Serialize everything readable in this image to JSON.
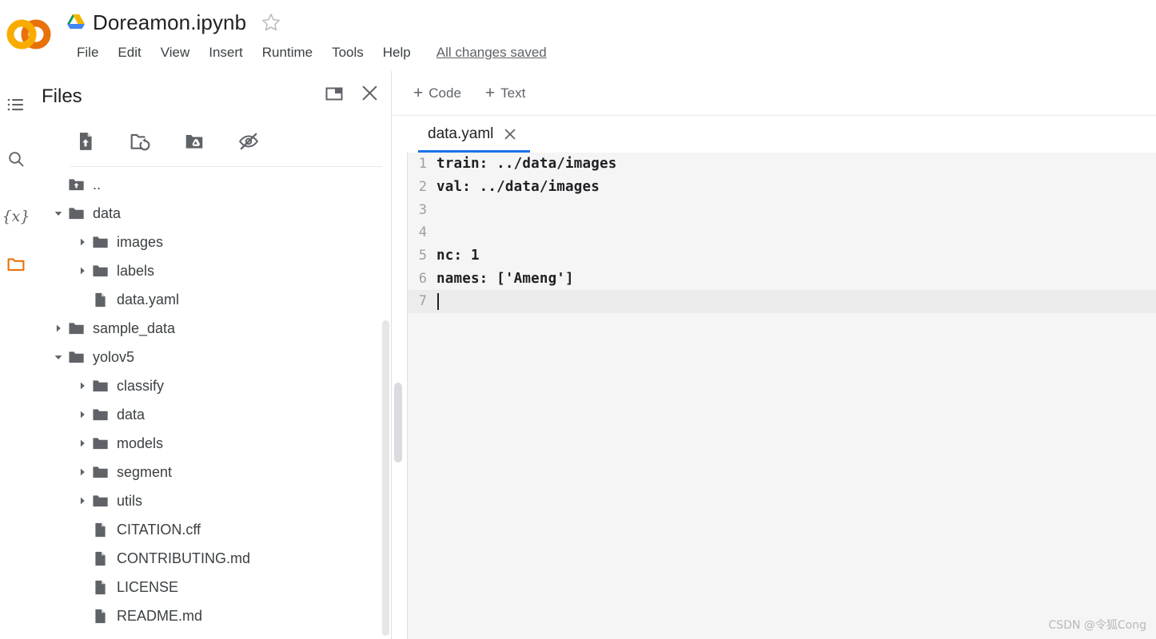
{
  "app": {
    "name": "Google Colaboratory",
    "logo_colors": {
      "light_orange": "#F9AB00",
      "dark_orange": "#E8710A"
    },
    "accent_blue": "#1a73e8"
  },
  "titlebar": {
    "doc_title": "Doreamon.ipynb",
    "drive_icon": "google-drive-icon",
    "star_icon": "star-icon",
    "star_filled": false
  },
  "menubar": {
    "items": [
      {
        "label": "File",
        "name": "menu-file"
      },
      {
        "label": "Edit",
        "name": "menu-edit"
      },
      {
        "label": "View",
        "name": "menu-view"
      },
      {
        "label": "Insert",
        "name": "menu-insert"
      },
      {
        "label": "Runtime",
        "name": "menu-runtime"
      },
      {
        "label": "Tools",
        "name": "menu-tools"
      },
      {
        "label": "Help",
        "name": "menu-help"
      }
    ],
    "save_status": "All changes saved"
  },
  "rail": {
    "items": [
      {
        "name": "table-of-contents-icon",
        "label": "Table of contents",
        "active": false
      },
      {
        "name": "search-icon",
        "label": "Find and replace",
        "active": false
      },
      {
        "name": "variables-icon",
        "label": "Variables",
        "active": false
      },
      {
        "name": "files-folder-icon",
        "label": "Files",
        "active": true
      }
    ]
  },
  "files_panel": {
    "title": "Files",
    "header_actions": [
      {
        "name": "open-in-panel-icon",
        "label": "Open in new panel"
      },
      {
        "name": "close-icon",
        "label": "Close"
      }
    ],
    "toolbar": [
      {
        "name": "upload-file-icon",
        "label": "Upload to session storage"
      },
      {
        "name": "refresh-folder-icon",
        "label": "Refresh"
      },
      {
        "name": "mount-drive-icon",
        "label": "Mount Drive"
      },
      {
        "name": "hide-hidden-files-icon",
        "label": "Show/hide hidden files"
      }
    ],
    "tree": [
      {
        "label": "..",
        "type": "parent",
        "depth": 0,
        "twisty": "none",
        "icon": "folder-up-icon"
      },
      {
        "label": "data",
        "type": "folder",
        "depth": 0,
        "twisty": "expanded",
        "icon": "folder-icon"
      },
      {
        "label": "images",
        "type": "folder",
        "depth": 1,
        "twisty": "collapsed",
        "icon": "folder-icon"
      },
      {
        "label": "labels",
        "type": "folder",
        "depth": 1,
        "twisty": "collapsed",
        "icon": "folder-icon"
      },
      {
        "label": "data.yaml",
        "type": "file",
        "depth": 1,
        "twisty": "none",
        "icon": "file-icon"
      },
      {
        "label": "sample_data",
        "type": "folder",
        "depth": 0,
        "twisty": "collapsed",
        "icon": "folder-icon"
      },
      {
        "label": "yolov5",
        "type": "folder",
        "depth": 0,
        "twisty": "expanded",
        "icon": "folder-icon"
      },
      {
        "label": "classify",
        "type": "folder",
        "depth": 1,
        "twisty": "collapsed",
        "icon": "folder-icon"
      },
      {
        "label": "data",
        "type": "folder",
        "depth": 1,
        "twisty": "collapsed",
        "icon": "folder-icon"
      },
      {
        "label": "models",
        "type": "folder",
        "depth": 1,
        "twisty": "collapsed",
        "icon": "folder-icon"
      },
      {
        "label": "segment",
        "type": "folder",
        "depth": 1,
        "twisty": "collapsed",
        "icon": "folder-icon"
      },
      {
        "label": "utils",
        "type": "folder",
        "depth": 1,
        "twisty": "collapsed",
        "icon": "folder-icon"
      },
      {
        "label": "CITATION.cff",
        "type": "file",
        "depth": 1,
        "twisty": "none",
        "icon": "file-icon"
      },
      {
        "label": "CONTRIBUTING.md",
        "type": "file",
        "depth": 1,
        "twisty": "none",
        "icon": "file-icon"
      },
      {
        "label": "LICENSE",
        "type": "file",
        "depth": 1,
        "twisty": "none",
        "icon": "file-icon"
      },
      {
        "label": "README.md",
        "type": "file",
        "depth": 1,
        "twisty": "none",
        "icon": "file-icon"
      }
    ]
  },
  "editor": {
    "cell_buttons": [
      {
        "label": "Code",
        "name": "add-code-cell-button"
      },
      {
        "label": "Text",
        "name": "add-text-cell-button"
      }
    ],
    "tab": {
      "label": "data.yaml",
      "close_icon": "close-icon",
      "active": true
    },
    "lines": [
      {
        "no": "1",
        "text": "train: ../data/images"
      },
      {
        "no": "2",
        "text": "val: ../data/images"
      },
      {
        "no": "3",
        "text": ""
      },
      {
        "no": "4",
        "text": ""
      },
      {
        "no": "5",
        "text": "nc: 1"
      },
      {
        "no": "6",
        "text": "names: ['Ameng']"
      },
      {
        "no": "7",
        "text": ""
      }
    ],
    "active_line": "7",
    "cursor_line": "7"
  },
  "watermark": "CSDN @令狐Cong"
}
